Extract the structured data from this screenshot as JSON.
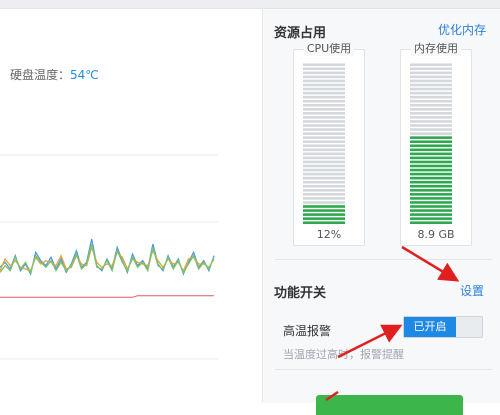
{
  "left": {
    "disk_temp_label": "硬盘温度：",
    "disk_temp_value": "54℃"
  },
  "resource": {
    "title": "资源占用",
    "optimize_link": "优化内存",
    "cpu": {
      "caption": "CPU使用",
      "value_text": "12%",
      "level": 0.12
    },
    "memory": {
      "caption": "内存使用",
      "value_text": "8.9 GB",
      "level": 0.55
    }
  },
  "features": {
    "title": "功能开关",
    "settings_link": "设置",
    "high_temp_alarm": {
      "label": "高温报警",
      "state_label": "已开启",
      "enabled": true,
      "hint": "当温度过高时，报警提醒"
    }
  },
  "colors": {
    "accent_blue": "#1e88e5",
    "link_blue": "#2b7fd6",
    "meter_green": "#2fa84f",
    "meter_gray": "#d4d7db",
    "arrow_red": "#e02020",
    "button_green": "#3cb64b"
  },
  "chart_data": {
    "type": "line",
    "x": [
      0,
      1,
      2,
      3,
      4,
      5,
      6,
      7,
      8,
      9,
      10,
      11,
      12,
      13,
      14,
      15,
      16,
      17,
      18,
      19,
      20,
      21,
      22,
      23,
      24,
      25,
      26,
      27,
      28,
      29,
      30,
      31,
      32,
      33,
      34,
      35,
      36,
      37,
      38,
      39,
      40,
      41,
      42
    ],
    "series": [
      {
        "values": [
          48,
          51,
          47,
          55,
          46,
          50,
          44,
          57,
          52,
          49,
          54,
          47,
          53,
          45,
          50,
          58,
          48,
          51,
          65,
          49,
          46,
          53,
          47,
          60,
          52,
          45,
          56,
          49,
          52,
          47,
          62,
          50,
          46,
          55,
          48,
          53,
          44,
          51,
          57,
          48,
          52,
          46,
          55
        ]
      },
      {
        "values": [
          46,
          53,
          49,
          52,
          48,
          47,
          46,
          54,
          50,
          52,
          51,
          49,
          55,
          47,
          48,
          55,
          50,
          49,
          60,
          51,
          48,
          50,
          49,
          57,
          54,
          47,
          53,
          51,
          50,
          49,
          58,
          52,
          48,
          53,
          50,
          51,
          46,
          53,
          54,
          50,
          50,
          48,
          53
        ]
      },
      {
        "values": [
          45,
          49,
          46,
          54,
          47,
          51,
          45,
          55,
          51,
          48,
          52,
          46,
          51,
          46,
          49,
          56,
          47,
          50,
          62,
          48,
          47,
          52,
          46,
          58,
          51,
          46,
          54,
          48,
          51,
          46,
          60,
          49,
          47,
          54,
          47,
          52,
          45,
          50,
          55,
          47,
          51,
          47,
          54
        ]
      },
      {
        "values": [
          30,
          30,
          30,
          30,
          30,
          30,
          30,
          30,
          30,
          30,
          30,
          30,
          30,
          30,
          30,
          30,
          30,
          30,
          30,
          30,
          30,
          30,
          30,
          30,
          30,
          30,
          30,
          31,
          31,
          31,
          31,
          31,
          31,
          31,
          31,
          31,
          31,
          31,
          31,
          31,
          31,
          31,
          31
        ]
      }
    ],
    "series_colors": [
      "#4f9bd9",
      "#e6a33a",
      "#7cc36b",
      "#e85a5a"
    ],
    "ylim": [
      20,
      80
    ],
    "grid": true
  }
}
